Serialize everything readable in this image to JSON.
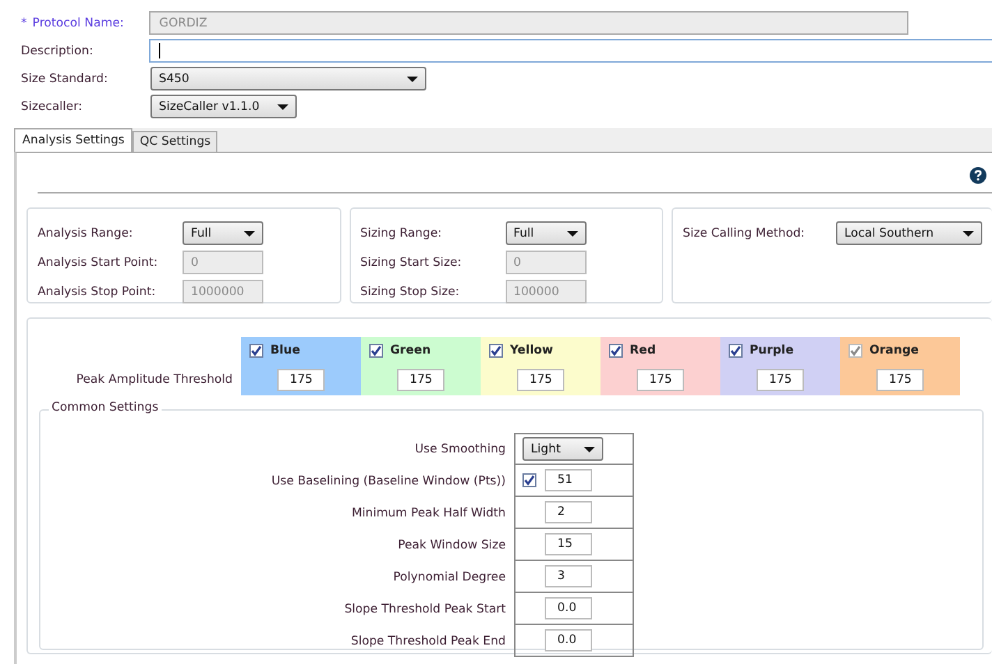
{
  "form": [
    {
      "label": "Protocol Name:",
      "required_mark": "*",
      "kind": "text",
      "value": "GORDIZ",
      "disabled": true
    },
    {
      "label": "Description:",
      "kind": "text",
      "disabled": false
    },
    {
      "label": "Size Standard:",
      "kind": "select",
      "value": "S450"
    },
    {
      "label": "Sizecaller:",
      "kind": "select",
      "value": "SizeCaller v1.1.0"
    }
  ],
  "tabs": [
    {
      "label": "Analysis Settings",
      "selected": true
    },
    {
      "label": "QC Settings",
      "selected": false
    }
  ],
  "range_groups": [
    {
      "rows": [
        {
          "label": "Analysis Range:",
          "kind": "select",
          "value": "Full"
        },
        {
          "label": "Analysis Start Point:",
          "kind": "text",
          "value": "0"
        },
        {
          "label": "Analysis Stop Point:",
          "kind": "text",
          "value": "1000000"
        }
      ]
    },
    {
      "rows": [
        {
          "label": "Sizing Range:",
          "kind": "select",
          "value": "Full"
        },
        {
          "label": "Sizing Start Size:",
          "kind": "text",
          "value": "0"
        },
        {
          "label": "Sizing Stop Size:",
          "kind": "text",
          "value": "100000"
        }
      ]
    },
    {
      "rows": [
        {
          "label": "Size Calling Method:",
          "kind": "select",
          "value": "Local Southern"
        }
      ]
    }
  ],
  "threshold": {
    "label": "Peak Amplitude Threshold",
    "channels": [
      {
        "name": "Blue",
        "color": "#9ccbfc",
        "checked": true,
        "disabled": false,
        "value": "175"
      },
      {
        "name": "Green",
        "color": "#ccfcd0",
        "checked": true,
        "disabled": false,
        "value": "175"
      },
      {
        "name": "Yellow",
        "color": "#fcfccc",
        "checked": true,
        "disabled": false,
        "value": "175"
      },
      {
        "name": "Red",
        "color": "#fcd0d0",
        "checked": true,
        "disabled": false,
        "value": "175"
      },
      {
        "name": "Purple",
        "color": "#d0d0f4",
        "checked": true,
        "disabled": false,
        "value": "175"
      },
      {
        "name": "Orange",
        "color": "#fcc898",
        "checked": true,
        "disabled": true,
        "value": "175"
      }
    ]
  },
  "common_settings": {
    "title": "Common Settings",
    "rows": [
      {
        "label": "Use Smoothing",
        "kind": "select",
        "value": "Light"
      },
      {
        "label": "Use Baselining (Baseline Window (Pts))",
        "kind": "check-number",
        "checked": true,
        "value": "51"
      },
      {
        "label": "Minimum Peak Half Width",
        "kind": "number",
        "value": "2"
      },
      {
        "label": "Peak Window Size",
        "kind": "number",
        "value": "15"
      },
      {
        "label": "Polynomial Degree",
        "kind": "number",
        "value": "3"
      },
      {
        "label": "Slope Threshold Peak Start",
        "kind": "number",
        "value": "0.0"
      },
      {
        "label": "Slope Threshold Peak End",
        "kind": "number",
        "value": "0.0"
      }
    ]
  }
}
